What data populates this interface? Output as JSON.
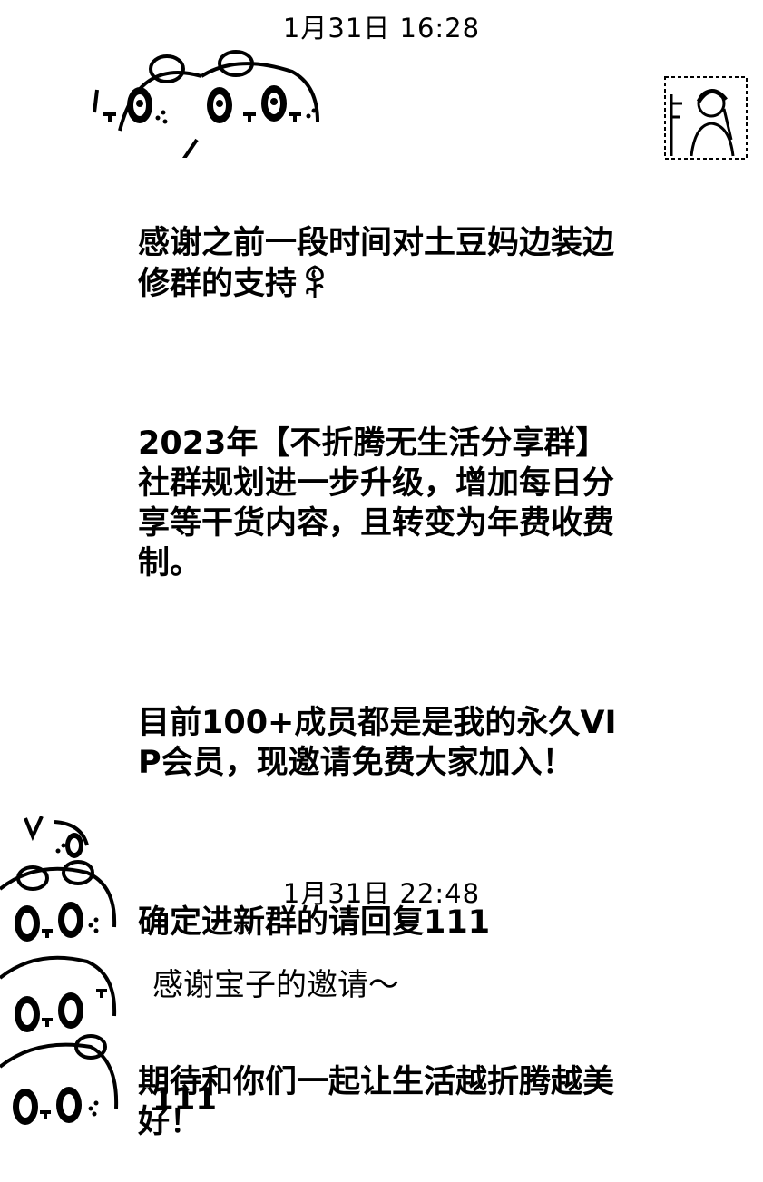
{
  "chat": {
    "messages": [
      {
        "timestamp": "1月31日 16:28",
        "paragraphs": [
          "感谢之前一段时间对土豆妈边装边修群的支持",
          "2023年【不折腾无生活分享群】社群规划进一步升级，增加每日分享等干货内容，且转变为年费收费制。",
          "目前100+成员都是是我的永久VIP会员，现邀请免费大家加入！",
          "确定进新群的请回复111",
          "期待和你们一起让生活越折腾越美好！"
        ],
        "emoji": "rose-icon"
      },
      {
        "timestamp": "1月31日 22:48",
        "text": "感谢宝子的邀请～"
      },
      {
        "text": "111"
      }
    ]
  },
  "icons": {
    "avatar": "user-avatar-icon",
    "decor_top": "panda-sticker-icon",
    "decor_left": "panda-stack-sticker-icon"
  },
  "colors": {
    "background": "#ffffff",
    "text": "#000000"
  }
}
